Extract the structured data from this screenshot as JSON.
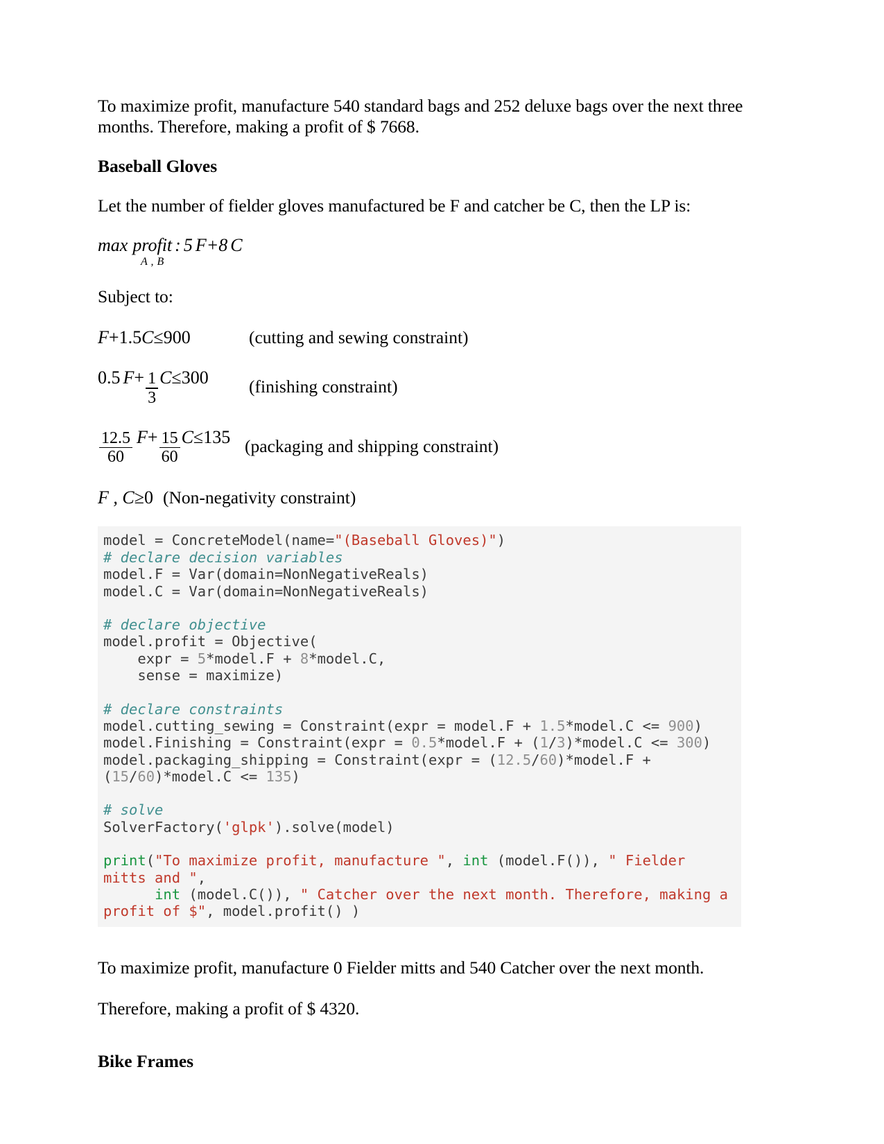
{
  "document": {
    "intro_paragraph": "To maximize profit, manufacture 540 standard bags and 252 deluxe bags over the next three months. Therefore, making a profit of $ 7668.",
    "section_heading": "Baseball Gloves",
    "lp_intro": "Let the number of fielder gloves manufactured be F and catcher be C, then the LP is:",
    "subject_to_label": "Subject to:",
    "result_paragraph_1": "To maximize profit, manufacture 0 Fielder mitts and 540 Catcher over the next month.",
    "result_paragraph_2": "Therefore, making a profit of $ 4320.",
    "next_section_heading": "Bike Frames"
  },
  "objective": {
    "max_label": "max",
    "profit_label": "profit",
    "subscript": "A , B",
    "colon": ":",
    "coef_F": "5",
    "var_F": "F",
    "plus": "+",
    "coef_C": "8",
    "var_C": "C"
  },
  "constraints": [
    {
      "id": "cutting-sewing",
      "expression": "F + 1.5 C ≤ 900",
      "parts": {
        "var1": "F",
        "op1": "+",
        "coef2": "1.5",
        "var2": "C",
        "rel": "≤",
        "rhs": "900"
      },
      "note": "(cutting and sewing constraint)"
    },
    {
      "id": "finishing",
      "expression": "0.5 F + (1/3) C ≤ 300",
      "parts": {
        "coef1": "0.5",
        "var1": "F",
        "op1": "+",
        "frac_num": "1",
        "frac_den": "3",
        "var2": "C",
        "rel": "≤",
        "rhs": "300"
      },
      "note": "(finishing constraint)"
    },
    {
      "id": "packaging-shipping",
      "expression": "(12.5/60) F + (15/60) C ≤ 135",
      "parts": {
        "frac1_num": "12.5",
        "frac1_den": "60",
        "var1": "F",
        "op1": "+",
        "frac2_num": "15",
        "frac2_den": "60",
        "var2": "C",
        "rel": "≤",
        "rhs": "135"
      },
      "note": "(packaging and shipping constraint)"
    }
  ],
  "nonnegativity": {
    "vars": "F , C",
    "rel": "≥",
    "rhs": "0",
    "note": "(Non-negativity constraint)"
  },
  "code": {
    "language": "python",
    "colors": {
      "background": "#f4f4f4",
      "plain": "#3c3c3c",
      "comment": "#408f8f",
      "string": "#c0392b",
      "number": "#8f8f8f",
      "builtin": "#1a9641"
    },
    "lines": [
      {
        "type": "mixed",
        "segments": [
          {
            "t": "plain",
            "v": "model = ConcreteModel(name="
          },
          {
            "t": "string",
            "v": "\"(Baseball Gloves)\""
          },
          {
            "t": "plain",
            "v": ")"
          }
        ]
      },
      {
        "type": "mixed",
        "segments": [
          {
            "t": "comment",
            "v": "# declare decision variables"
          }
        ]
      },
      {
        "type": "mixed",
        "segments": [
          {
            "t": "plain",
            "v": "model.F = Var(domain=NonNegativeReals)"
          }
        ]
      },
      {
        "type": "mixed",
        "segments": [
          {
            "t": "plain",
            "v": "model.C = Var(domain=NonNegativeReals)"
          }
        ]
      },
      {
        "type": "blank",
        "segments": []
      },
      {
        "type": "mixed",
        "segments": [
          {
            "t": "comment",
            "v": "# declare objective"
          }
        ]
      },
      {
        "type": "mixed",
        "segments": [
          {
            "t": "plain",
            "v": "model.profit = Objective("
          }
        ]
      },
      {
        "type": "mixed",
        "segments": [
          {
            "t": "plain",
            "v": "    expr = "
          },
          {
            "t": "number",
            "v": "5"
          },
          {
            "t": "plain",
            "v": "*model.F + "
          },
          {
            "t": "number",
            "v": "8"
          },
          {
            "t": "plain",
            "v": "*model.C,"
          }
        ]
      },
      {
        "type": "mixed",
        "segments": [
          {
            "t": "plain",
            "v": "    sense = maximize)"
          }
        ]
      },
      {
        "type": "blank",
        "segments": []
      },
      {
        "type": "mixed",
        "segments": [
          {
            "t": "comment",
            "v": "# declare constraints"
          }
        ]
      },
      {
        "type": "mixed",
        "segments": [
          {
            "t": "plain",
            "v": "model.cutting_sewing = Constraint(expr = model.F + "
          },
          {
            "t": "number",
            "v": "1.5"
          },
          {
            "t": "plain",
            "v": "*model.C <= "
          },
          {
            "t": "number",
            "v": "900"
          },
          {
            "t": "plain",
            "v": ")"
          }
        ]
      },
      {
        "type": "mixed",
        "segments": [
          {
            "t": "plain",
            "v": "model.Finishing = Constraint(expr = "
          },
          {
            "t": "number",
            "v": "0.5"
          },
          {
            "t": "plain",
            "v": "*model.F + ("
          },
          {
            "t": "number",
            "v": "1"
          },
          {
            "t": "plain",
            "v": "/"
          },
          {
            "t": "number",
            "v": "3"
          },
          {
            "t": "plain",
            "v": ")*model.C <= "
          },
          {
            "t": "number",
            "v": "300"
          },
          {
            "t": "plain",
            "v": ")"
          }
        ]
      },
      {
        "type": "mixed",
        "segments": [
          {
            "t": "plain",
            "v": "model.packaging_shipping = Constraint(expr = ("
          },
          {
            "t": "number",
            "v": "12.5"
          },
          {
            "t": "plain",
            "v": "/"
          },
          {
            "t": "number",
            "v": "60"
          },
          {
            "t": "plain",
            "v": ")*model.F + ("
          },
          {
            "t": "number",
            "v": "15"
          },
          {
            "t": "plain",
            "v": "/"
          },
          {
            "t": "number",
            "v": "60"
          },
          {
            "t": "plain",
            "v": ")*model.C <= "
          },
          {
            "t": "number",
            "v": "135"
          },
          {
            "t": "plain",
            "v": ")"
          }
        ]
      },
      {
        "type": "blank",
        "segments": []
      },
      {
        "type": "mixed",
        "segments": [
          {
            "t": "comment",
            "v": "# solve"
          }
        ]
      },
      {
        "type": "mixed",
        "segments": [
          {
            "t": "plain",
            "v": "SolverFactory("
          },
          {
            "t": "string",
            "v": "'glpk'"
          },
          {
            "t": "plain",
            "v": ").solve(model)"
          }
        ]
      },
      {
        "type": "blank",
        "segments": []
      },
      {
        "type": "mixed",
        "segments": [
          {
            "t": "builtin",
            "v": "print"
          },
          {
            "t": "plain",
            "v": "("
          },
          {
            "t": "string",
            "v": "\"To maximize profit, manufacture \""
          },
          {
            "t": "plain",
            "v": ", "
          },
          {
            "t": "builtin",
            "v": "int"
          },
          {
            "t": "plain",
            "v": " (model.F()), "
          },
          {
            "t": "string",
            "v": "\" Fielder mitts and \""
          },
          {
            "t": "plain",
            "v": ","
          }
        ]
      },
      {
        "type": "mixed",
        "segments": [
          {
            "t": "plain",
            "v": "      "
          },
          {
            "t": "builtin",
            "v": "int"
          },
          {
            "t": "plain",
            "v": " (model.C()), "
          },
          {
            "t": "string",
            "v": "\" Catcher over the next month. Therefore, making a profit of $\""
          },
          {
            "t": "plain",
            "v": ", model.profit() )"
          }
        ]
      }
    ]
  }
}
